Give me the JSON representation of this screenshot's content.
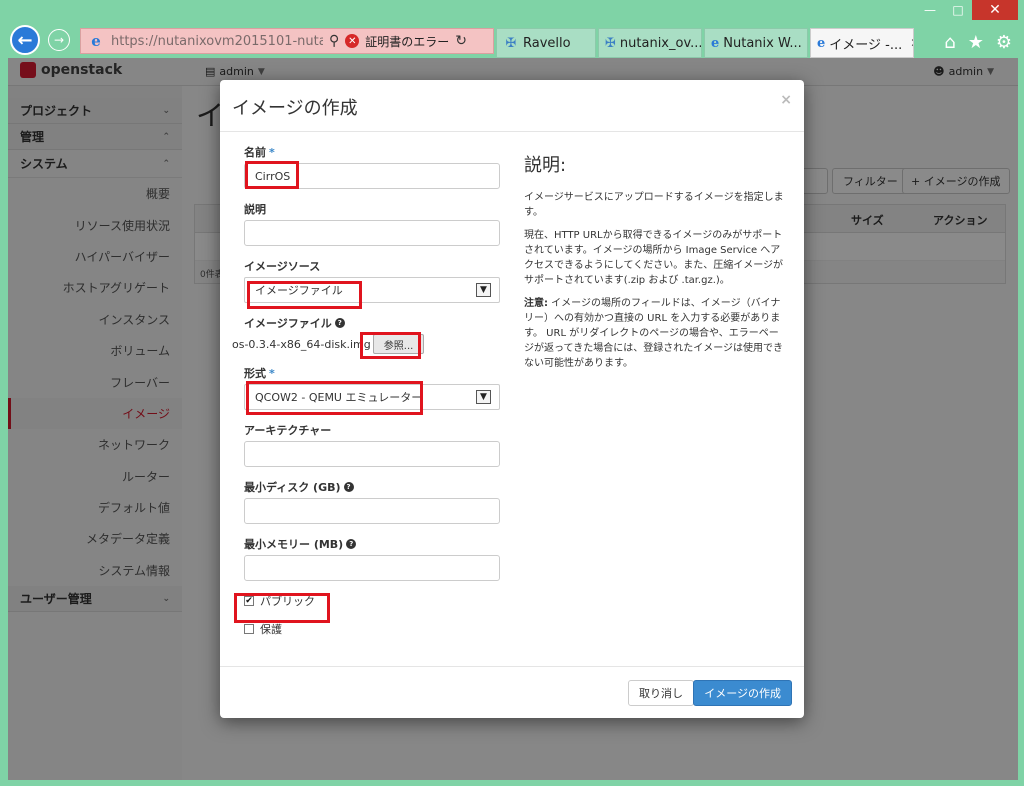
{
  "browser": {
    "url": "https://nutanixovm2015101-nutan...",
    "cert_error": "証明書のエラー",
    "tabs": [
      {
        "label": "Ravello",
        "icon": "pinwheel-icon"
      },
      {
        "label": "nutanix_ov...",
        "icon": "pinwheel-icon"
      },
      {
        "label": "Nutanix W...",
        "icon": "ie-icon"
      },
      {
        "label": "イメージ -...",
        "icon": "ie-icon",
        "active": true
      }
    ]
  },
  "header": {
    "logo": "openstack",
    "project_user": "admin",
    "user": "admin"
  },
  "sidebar": {
    "sections": {
      "project": "プロジェクト",
      "admin": "管理",
      "system": "システム",
      "user_mgmt": "ユーザー管理"
    },
    "items": [
      {
        "label": "概要"
      },
      {
        "label": "リソース使用状況"
      },
      {
        "label": "ハイパーバイザー"
      },
      {
        "label": "ホストアグリゲート"
      },
      {
        "label": "インスタンス"
      },
      {
        "label": "ボリューム"
      },
      {
        "label": "フレーバー"
      },
      {
        "label": "イメージ",
        "active": true
      },
      {
        "label": "ネットワーク"
      },
      {
        "label": "ルーター"
      },
      {
        "label": "デフォルト値"
      },
      {
        "label": "メタデータ定義"
      },
      {
        "label": "システム情報"
      }
    ]
  },
  "background_page": {
    "title": "イ",
    "filter_button": "フィルター",
    "create_button": "+ イメージの作成",
    "columns": {
      "size": "サイズ",
      "action": "アクション"
    },
    "footer": "0件表"
  },
  "modal": {
    "title": "イメージの作成",
    "close": "×",
    "fields": {
      "name": {
        "label": "名前",
        "required": "*",
        "value": "CirrOS"
      },
      "description": {
        "label": "説明",
        "value": ""
      },
      "image_source": {
        "label": "イメージソース",
        "value": "イメージファイル"
      },
      "image_file": {
        "label": "イメージファイル",
        "filename": "os-0.3.4-x86_64-disk.img",
        "browse": "参照..."
      },
      "format": {
        "label": "形式",
        "required": "*",
        "value": "QCOW2 - QEMU エミュレーター"
      },
      "architecture": {
        "label": "アーキテクチャー",
        "value": ""
      },
      "min_disk": {
        "label": "最小ディスク (GB)",
        "value": ""
      },
      "min_memory": {
        "label": "最小メモリー (MB)",
        "value": ""
      },
      "public": {
        "label": "パブリック",
        "checked": true
      },
      "protected": {
        "label": "保護",
        "checked": false
      }
    },
    "description": {
      "title": "説明:",
      "p1": "イメージサービスにアップロードするイメージを指定します。",
      "p2": "現在、HTTP URLから取得できるイメージのみがサポートされています。イメージの場所から Image Service へアクセスできるようにしてください。また、圧縮イメージがサポートされています(.zip および .tar.gz.)。",
      "note_label": "注意:",
      "note": " イメージの場所のフィールドは、イメージ（バイナリー）への有効かつ直接の URL を入力する必要があります。 URL がリダイレクトのページの場合や、エラーページが返ってきた場合には、登録されたイメージは使用できない可能性があります。"
    },
    "buttons": {
      "cancel": "取り消し",
      "create": "イメージの作成"
    }
  },
  "colors": {
    "accent_red": "#d51a2e",
    "primary_blue": "#3b8bd0",
    "highlight_box": "#e0141e"
  }
}
